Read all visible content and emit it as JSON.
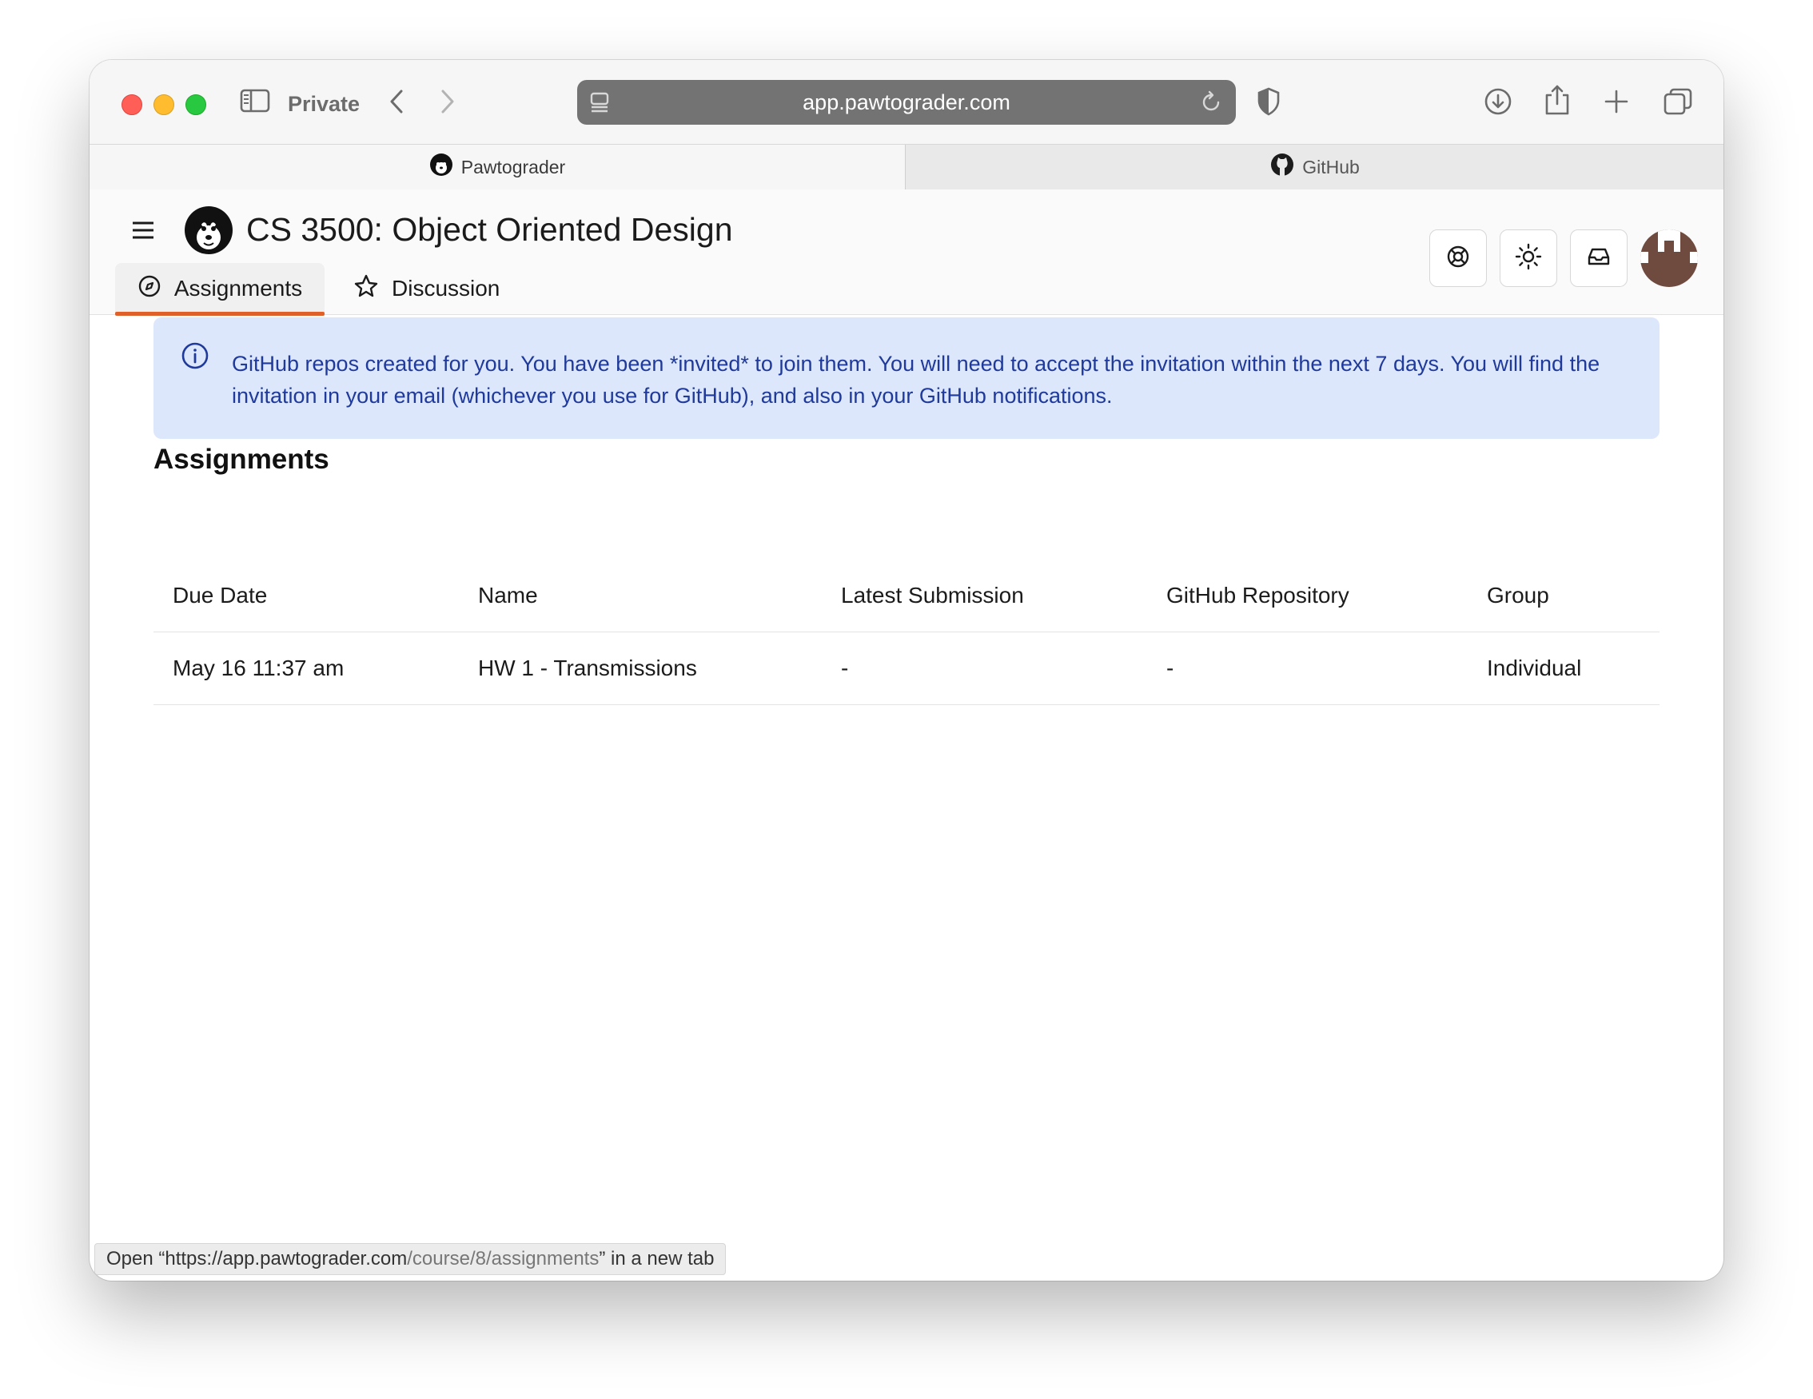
{
  "browser": {
    "private_label": "Private",
    "address": "app.pawtograder.com",
    "tabs": [
      {
        "label": "Pawtograder",
        "icon": "husky-logo-icon"
      },
      {
        "label": "GitHub",
        "icon": "github-icon"
      }
    ]
  },
  "app": {
    "course_title": "CS 3500: Object Oriented Design",
    "nav": [
      {
        "label": "Assignments",
        "icon": "compass-icon"
      },
      {
        "label": "Discussion",
        "icon": "star-icon"
      }
    ],
    "header_buttons": [
      "help-icon",
      "sun-icon",
      "inbox-icon"
    ]
  },
  "alert": {
    "text": "GitHub repos created for you. You have been *invited* to join them. You will need to accept the invitation within the next 7 days. You will find the invitation in your email (whichever you use for GitHub), and also in your GitHub notifications."
  },
  "assignments": {
    "title": "Assignments",
    "columns": [
      "Due Date",
      "Name",
      "Latest Submission",
      "GitHub Repository",
      "Group"
    ],
    "rows": [
      [
        "May 16 11:37 am",
        "HW 1 - Transmissions",
        "-",
        "-",
        "Individual"
      ]
    ]
  },
  "status_bar": {
    "prefix": "Open “",
    "url_host": "https://app.pawtograder.com",
    "url_path": "/course/8/assignments",
    "suffix": "” in a new tab"
  },
  "colors": {
    "accent": "#e0602a",
    "alert_bg": "#dde7fb",
    "alert_text": "#1f3a9a"
  }
}
